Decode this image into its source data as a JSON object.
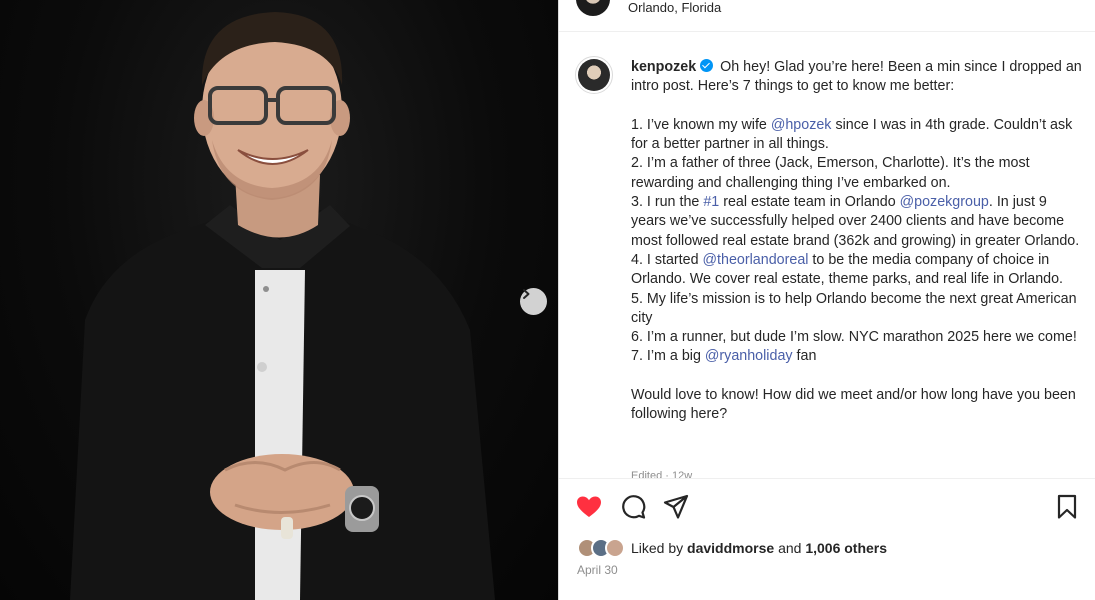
{
  "header": {
    "location": "Orlando, Florida"
  },
  "post": {
    "username": "kenpozek",
    "verified": true,
    "intro": "Oh hey! Glad you’re here! Been a min since I dropped an intro post. Here’s 7 things to get to know me better:",
    "item1_a": "1. I’ve known my wife ",
    "item1_mention": "@hpozek",
    "item1_b": " since I was in 4th grade. Couldn’t ask for a better partner in all things.",
    "item2": "2. I’m a father of three (Jack, Emerson, Charlotte). It’s the most rewarding and challenging thing I’ve embarked on.",
    "item3_a": "3. I run the ",
    "item3_hashtag": "#1",
    "item3_b": " real estate team in Orlando ",
    "item3_mention": "@pozekgroup",
    "item3_c": ". In just 9 years we’ve successfully helped over 2400 clients and have become most followed real estate brand (362k and growing) in greater Orlando.",
    "item4_a": "4. I started ",
    "item4_mention": "@theorlandoreal",
    "item4_b": " to be the media company of choice in Orlando. We cover real estate, theme parks, and real life in Orlando.",
    "item5": "5. My life’s mission is to help Orlando become the next great American city",
    "item6": "6. I’m a runner, but dude I’m slow. NYC marathon 2025 here we come!",
    "item7_a": "7. I’m a big ",
    "item7_mention": "@ryanholiday",
    "item7_b": " fan",
    "closing": "Would love to know! How did we meet and/or how long have you been following here?",
    "edited": "Edited · 12w"
  },
  "engagement": {
    "liked_by_prefix": "Liked by ",
    "liked_by_user": "daviddmorse",
    "and_text": " and ",
    "others": "1,006 others",
    "date": "April 30",
    "liked": true
  },
  "icons": {
    "like": "heart-icon",
    "comment": "comment-icon",
    "share": "paper-plane-icon",
    "save": "bookmark-icon",
    "next": "chevron-right-icon"
  },
  "colors": {
    "heart": "#ff3040",
    "mention": "#4a5fa8",
    "verified": "#0095f6"
  }
}
